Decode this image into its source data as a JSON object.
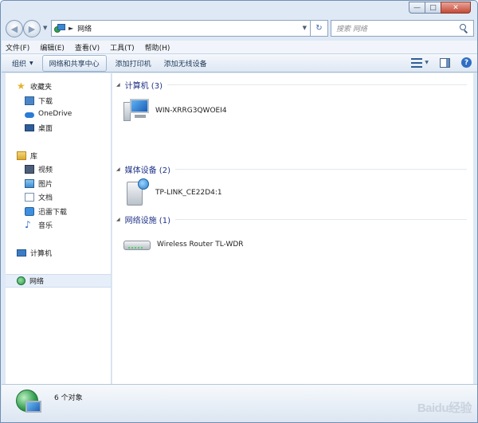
{
  "address": {
    "location": "网络"
  },
  "search": {
    "placeholder": "搜索 网络"
  },
  "menu": [
    "文件(F)",
    "编辑(E)",
    "查看(V)",
    "工具(T)",
    "帮助(H)"
  ],
  "toolbar": {
    "organize": "组织",
    "network_center": "网络和共享中心",
    "add_printer": "添加打印机",
    "add_wireless": "添加无线设备"
  },
  "sidebar": {
    "favorites": "收藏夹",
    "downloads": "下载",
    "onedrive": "OneDrive",
    "desktop": "桌面",
    "libraries": "库",
    "videos": "视频",
    "pictures": "图片",
    "documents": "文档",
    "thunder": "迅雷下载",
    "music": "音乐",
    "computer": "计算机",
    "network": "网络"
  },
  "groups": [
    {
      "title": "计算机 (3)",
      "items": [
        "WIN-XRRG3QWOEI4"
      ]
    },
    {
      "title": "媒体设备 (2)",
      "items": [
        "TP-LINK_CE22D4:1"
      ]
    },
    {
      "title": "网络设施 (1)",
      "items": [
        "Wireless Router TL-WDR"
      ]
    }
  ],
  "status": {
    "count": "6 个对象"
  },
  "watermark": "Baidu经验"
}
